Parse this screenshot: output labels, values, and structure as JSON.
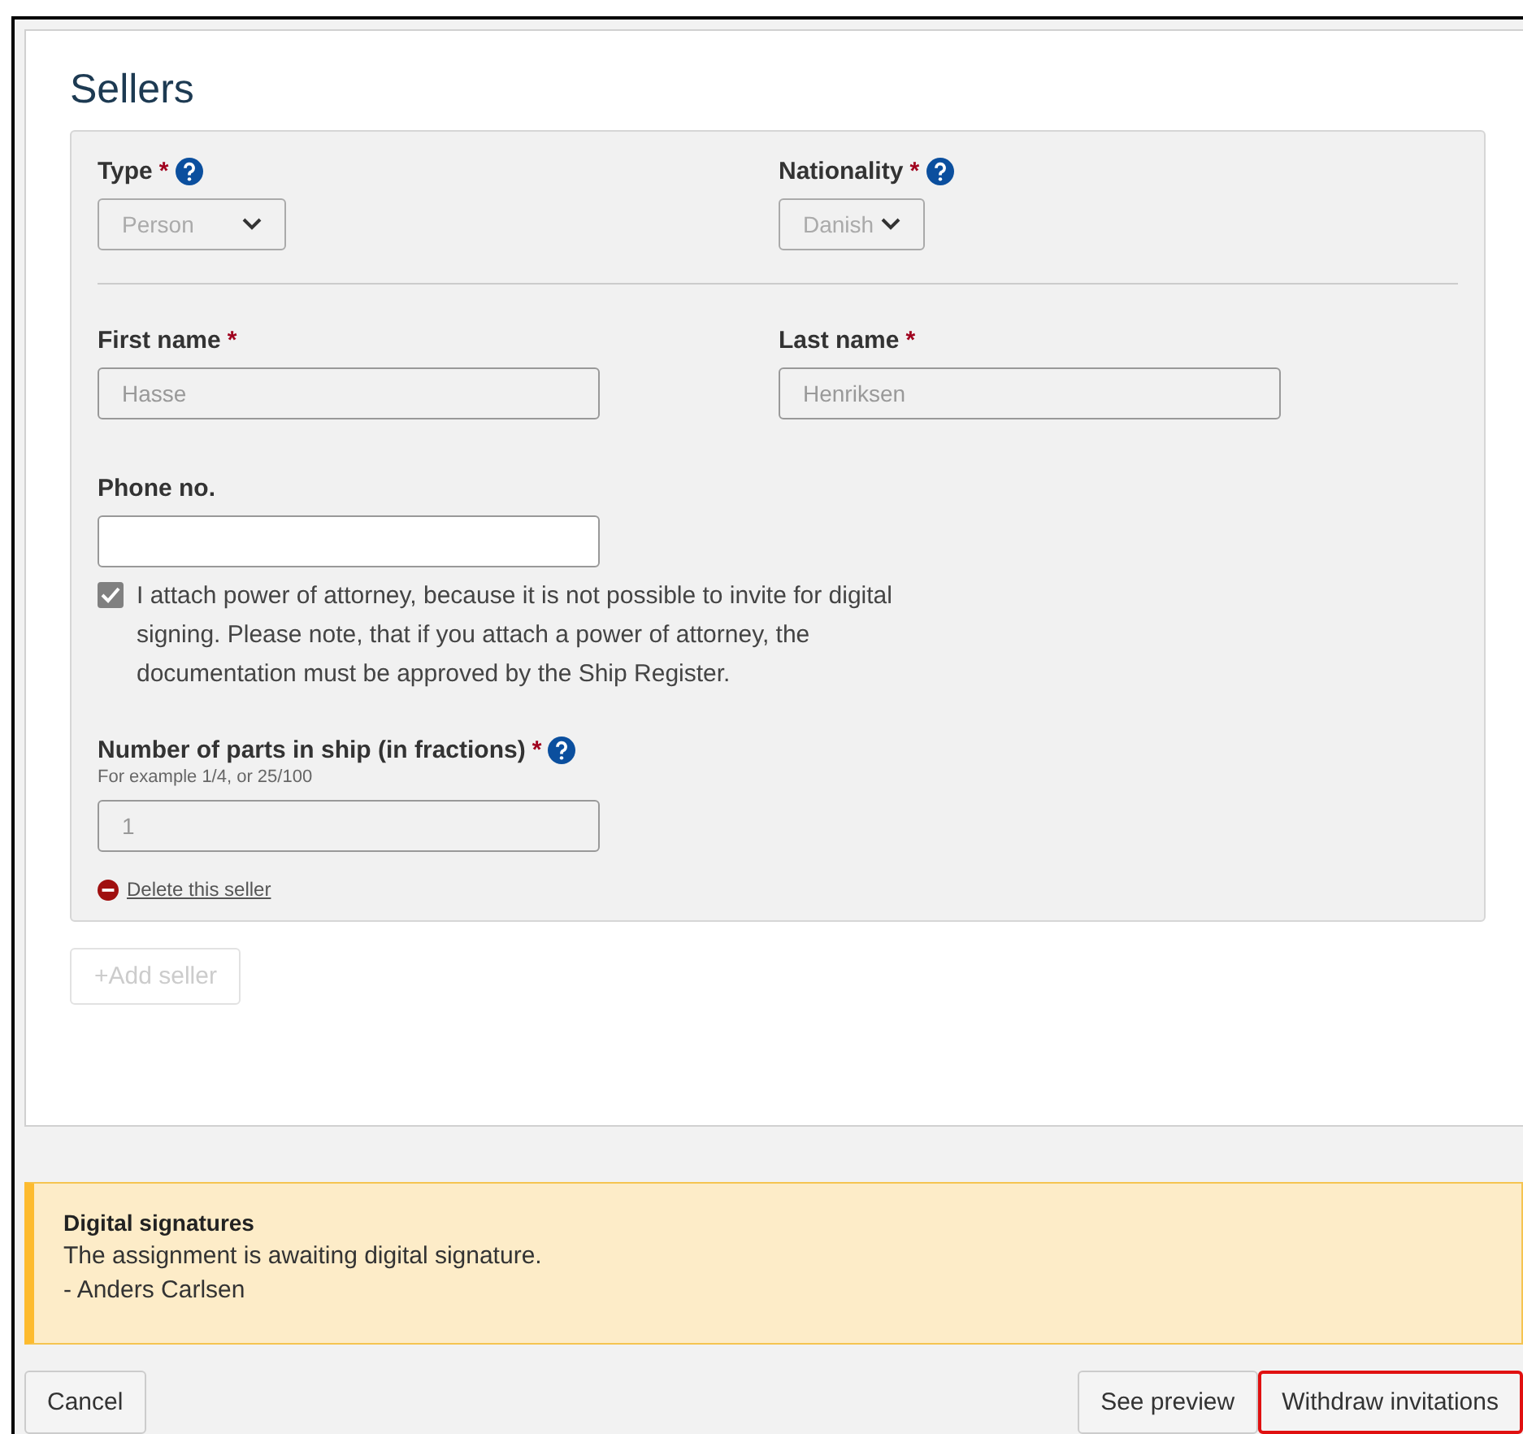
{
  "section": {
    "title": "Sellers"
  },
  "seller": {
    "type": {
      "label": "Type",
      "required_mark": "*",
      "value": "Person"
    },
    "nationality": {
      "label": "Nationality",
      "required_mark": "*",
      "value": "Danish"
    },
    "first_name": {
      "label": "First name",
      "required_mark": "*",
      "value": "Hasse"
    },
    "last_name": {
      "label": "Last name",
      "required_mark": "*",
      "value": "Henriksen"
    },
    "phone": {
      "label": "Phone no."
    },
    "power_of_attorney": {
      "checked": true,
      "text": "I attach power of attorney, because it is not possible to invite for digital signing. Please note, that if you attach a power of attorney, the documentation must be approved by the Ship Register."
    },
    "parts": {
      "label": "Number of parts in ship (in fractions)",
      "required_mark": "*",
      "hint": "For example 1/4, or 25/100",
      "value": "1"
    },
    "delete_link": "Delete this seller"
  },
  "add_button": {
    "label": "+Add seller",
    "disabled": true
  },
  "notice": {
    "title": "Digital signatures",
    "lines": [
      "The assignment is awaiting digital signature.",
      "- Anders Carlsen"
    ]
  },
  "actions": [
    {
      "label": "Cancel",
      "highlighted": false
    },
    {
      "label": "See preview",
      "highlighted": false
    },
    {
      "label": "Withdraw invitations",
      "highlighted": true
    }
  ]
}
